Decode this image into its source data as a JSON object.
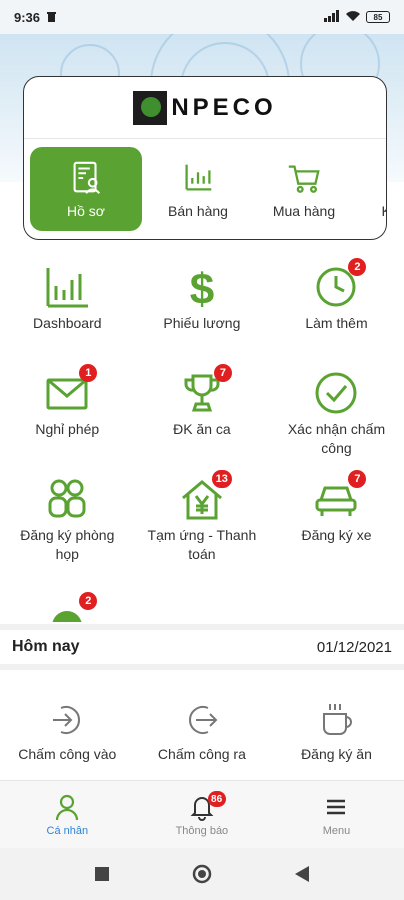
{
  "status_bar": {
    "time": "9:36",
    "battery": "85"
  },
  "brand": {
    "logo_text": "NPECO"
  },
  "quick_tabs": [
    {
      "label": "Hồ sơ",
      "icon": "profile-doc-icon",
      "active": true
    },
    {
      "label": "Bán hàng",
      "icon": "bar-chart-icon"
    },
    {
      "label": "Mua hàng",
      "icon": "cart-icon"
    },
    {
      "label": "Kế",
      "icon": "chart-icon"
    }
  ],
  "grid": [
    {
      "label": "Dashboard",
      "icon": "bar-chart-icon"
    },
    {
      "label": "Phiếu lương",
      "icon": "dollar-icon"
    },
    {
      "label": "Làm thêm",
      "icon": "clock-icon",
      "badge": "2"
    },
    {
      "label": "Nghỉ phép",
      "icon": "mail-icon",
      "badge": "1"
    },
    {
      "label": "ĐK ăn ca",
      "icon": "trophy-icon",
      "badge": "7"
    },
    {
      "label": "Xác nhận chấm công",
      "icon": "check-circle-icon"
    },
    {
      "label": "Đăng ký phòng họp",
      "icon": "meeting-icon"
    },
    {
      "label": "Tạm ứng - Thanh toán",
      "icon": "home-yen-icon",
      "badge": "13"
    },
    {
      "label": "Đăng ký xe",
      "icon": "car-icon",
      "badge": "7"
    },
    {
      "label": "",
      "icon": "partial-icon",
      "badge": "2"
    }
  ],
  "today": {
    "label": "Hôm nay",
    "date": "01/12/2021"
  },
  "attendance": [
    {
      "label": "Chấm công vào",
      "icon": "check-in-icon"
    },
    {
      "label": "Chấm công ra",
      "icon": "check-out-icon"
    },
    {
      "label": "Đăng ký ăn",
      "icon": "coffee-icon"
    }
  ],
  "bottom_nav": [
    {
      "label": "Cá nhân",
      "icon": "person-icon",
      "active": true
    },
    {
      "label": "Thông báo",
      "icon": "bell-icon",
      "badge": "86"
    },
    {
      "label": "Menu",
      "icon": "menu-icon"
    }
  ],
  "colors": {
    "green": "#5aa332",
    "badge_red": "#e02020",
    "nav_active": "#2e84d6"
  }
}
